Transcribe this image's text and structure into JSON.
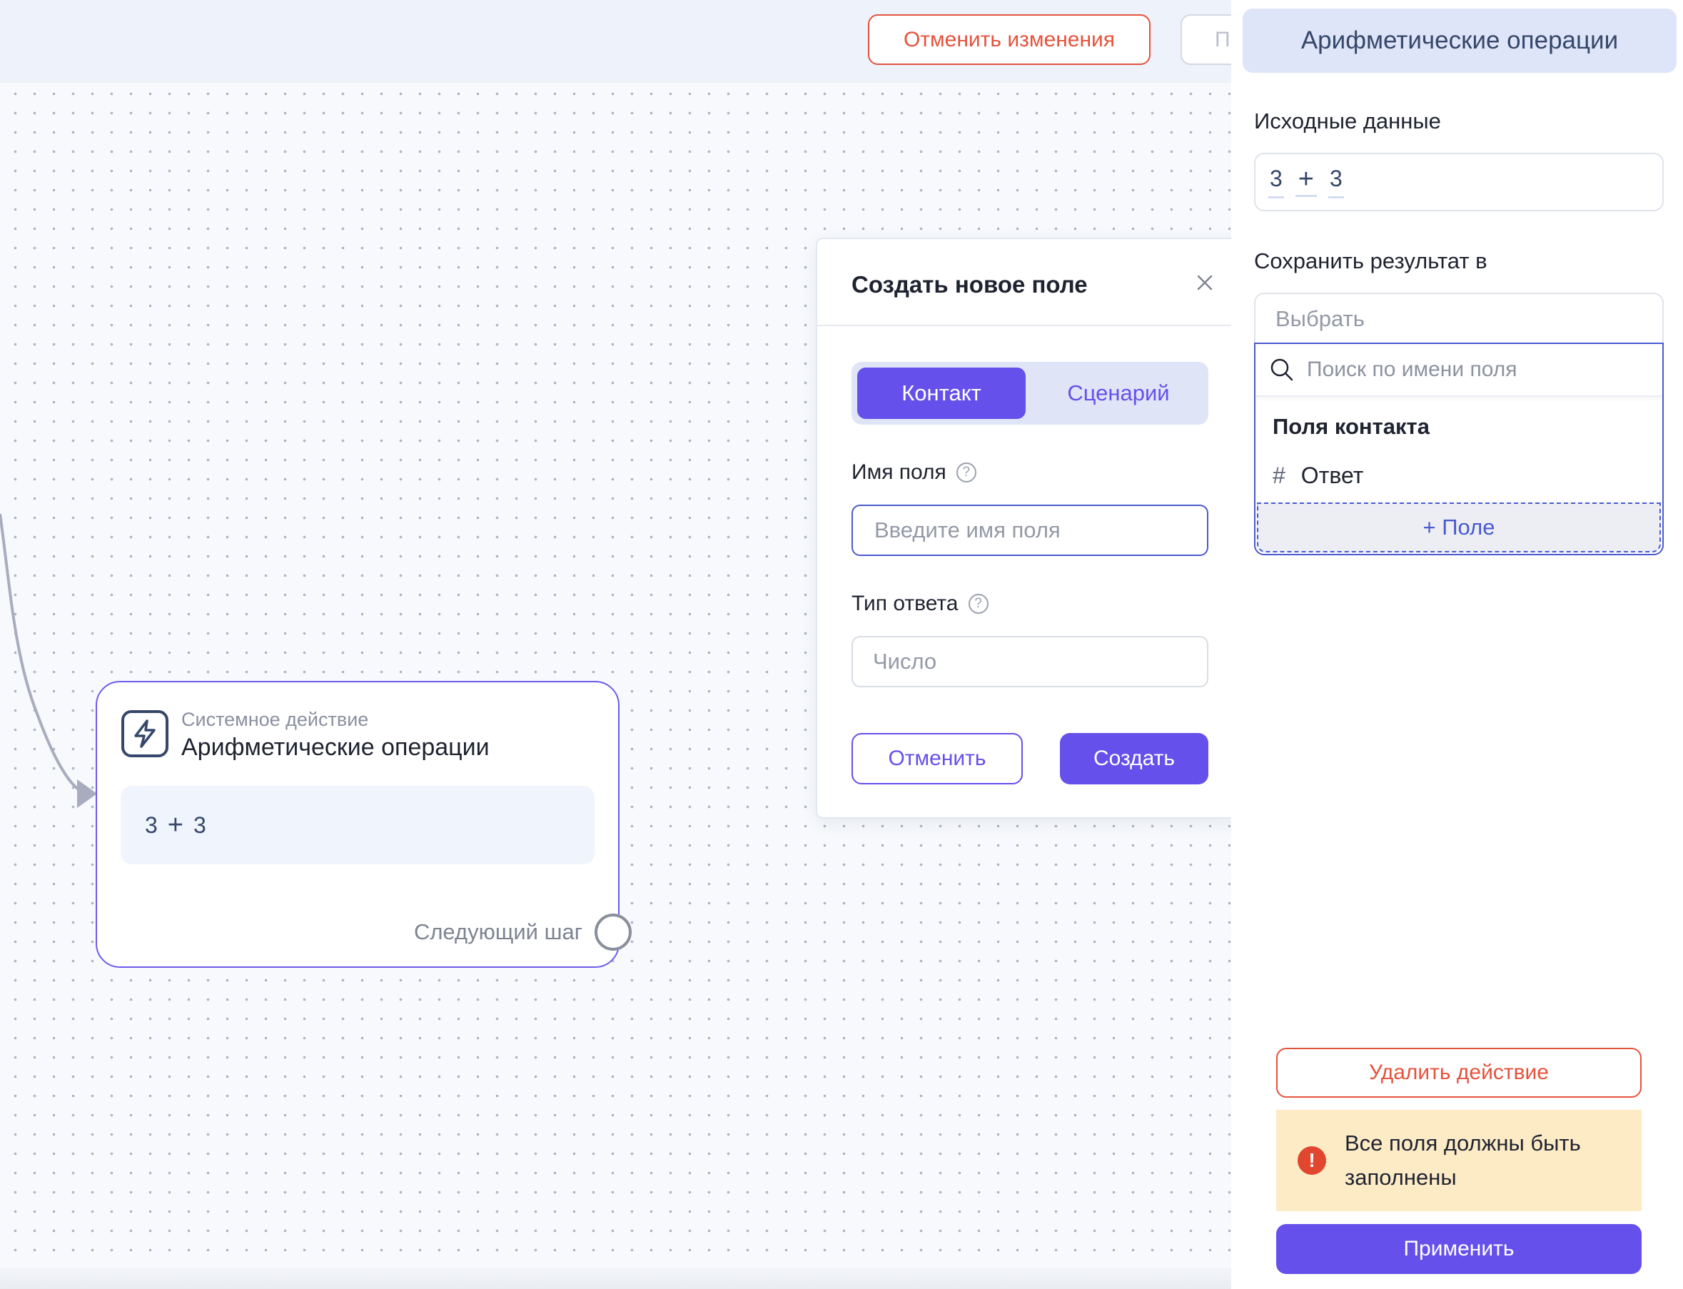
{
  "topbar": {
    "cancel_changes_label": "Отменить изменения",
    "publish_label_partial": "П"
  },
  "node": {
    "subtitle": "Системное действие",
    "title": "Арифметические операции",
    "expression": {
      "left": "3",
      "operator": "+",
      "right": "3"
    },
    "next_step_label": "Следующий шаг"
  },
  "modal": {
    "title": "Создать новое поле",
    "tabs": [
      {
        "label": "Контакт",
        "active": true
      },
      {
        "label": "Сценарий",
        "active": false
      }
    ],
    "field_name": {
      "label": "Имя поля",
      "placeholder": "Введите имя поля",
      "value": ""
    },
    "answer_type": {
      "label": "Тип ответа",
      "value": "Число"
    },
    "cancel_label": "Отменить",
    "create_label": "Создать"
  },
  "panel": {
    "title": "Арифметические операции",
    "source_label": "Исходные данные",
    "expression": {
      "left": "3",
      "operator": "+",
      "right": "3"
    },
    "save_label": "Сохранить результат в",
    "select_placeholder": "Выбрать",
    "dropdown": {
      "search_placeholder": "Поиск по имени поля",
      "group_title": "Поля контакта",
      "items": [
        {
          "label": "Ответ",
          "icon": "hash-icon"
        }
      ],
      "add_field_label": "+ Поле"
    },
    "delete_label": "Удалить действие",
    "alert_text": "Все поля должны быть заполнены",
    "apply_label": "Применить"
  },
  "colors": {
    "accent": "#6550eb",
    "danger": "#e5533d",
    "focus": "#4a5acf",
    "warning_bg": "#fdebc6"
  }
}
